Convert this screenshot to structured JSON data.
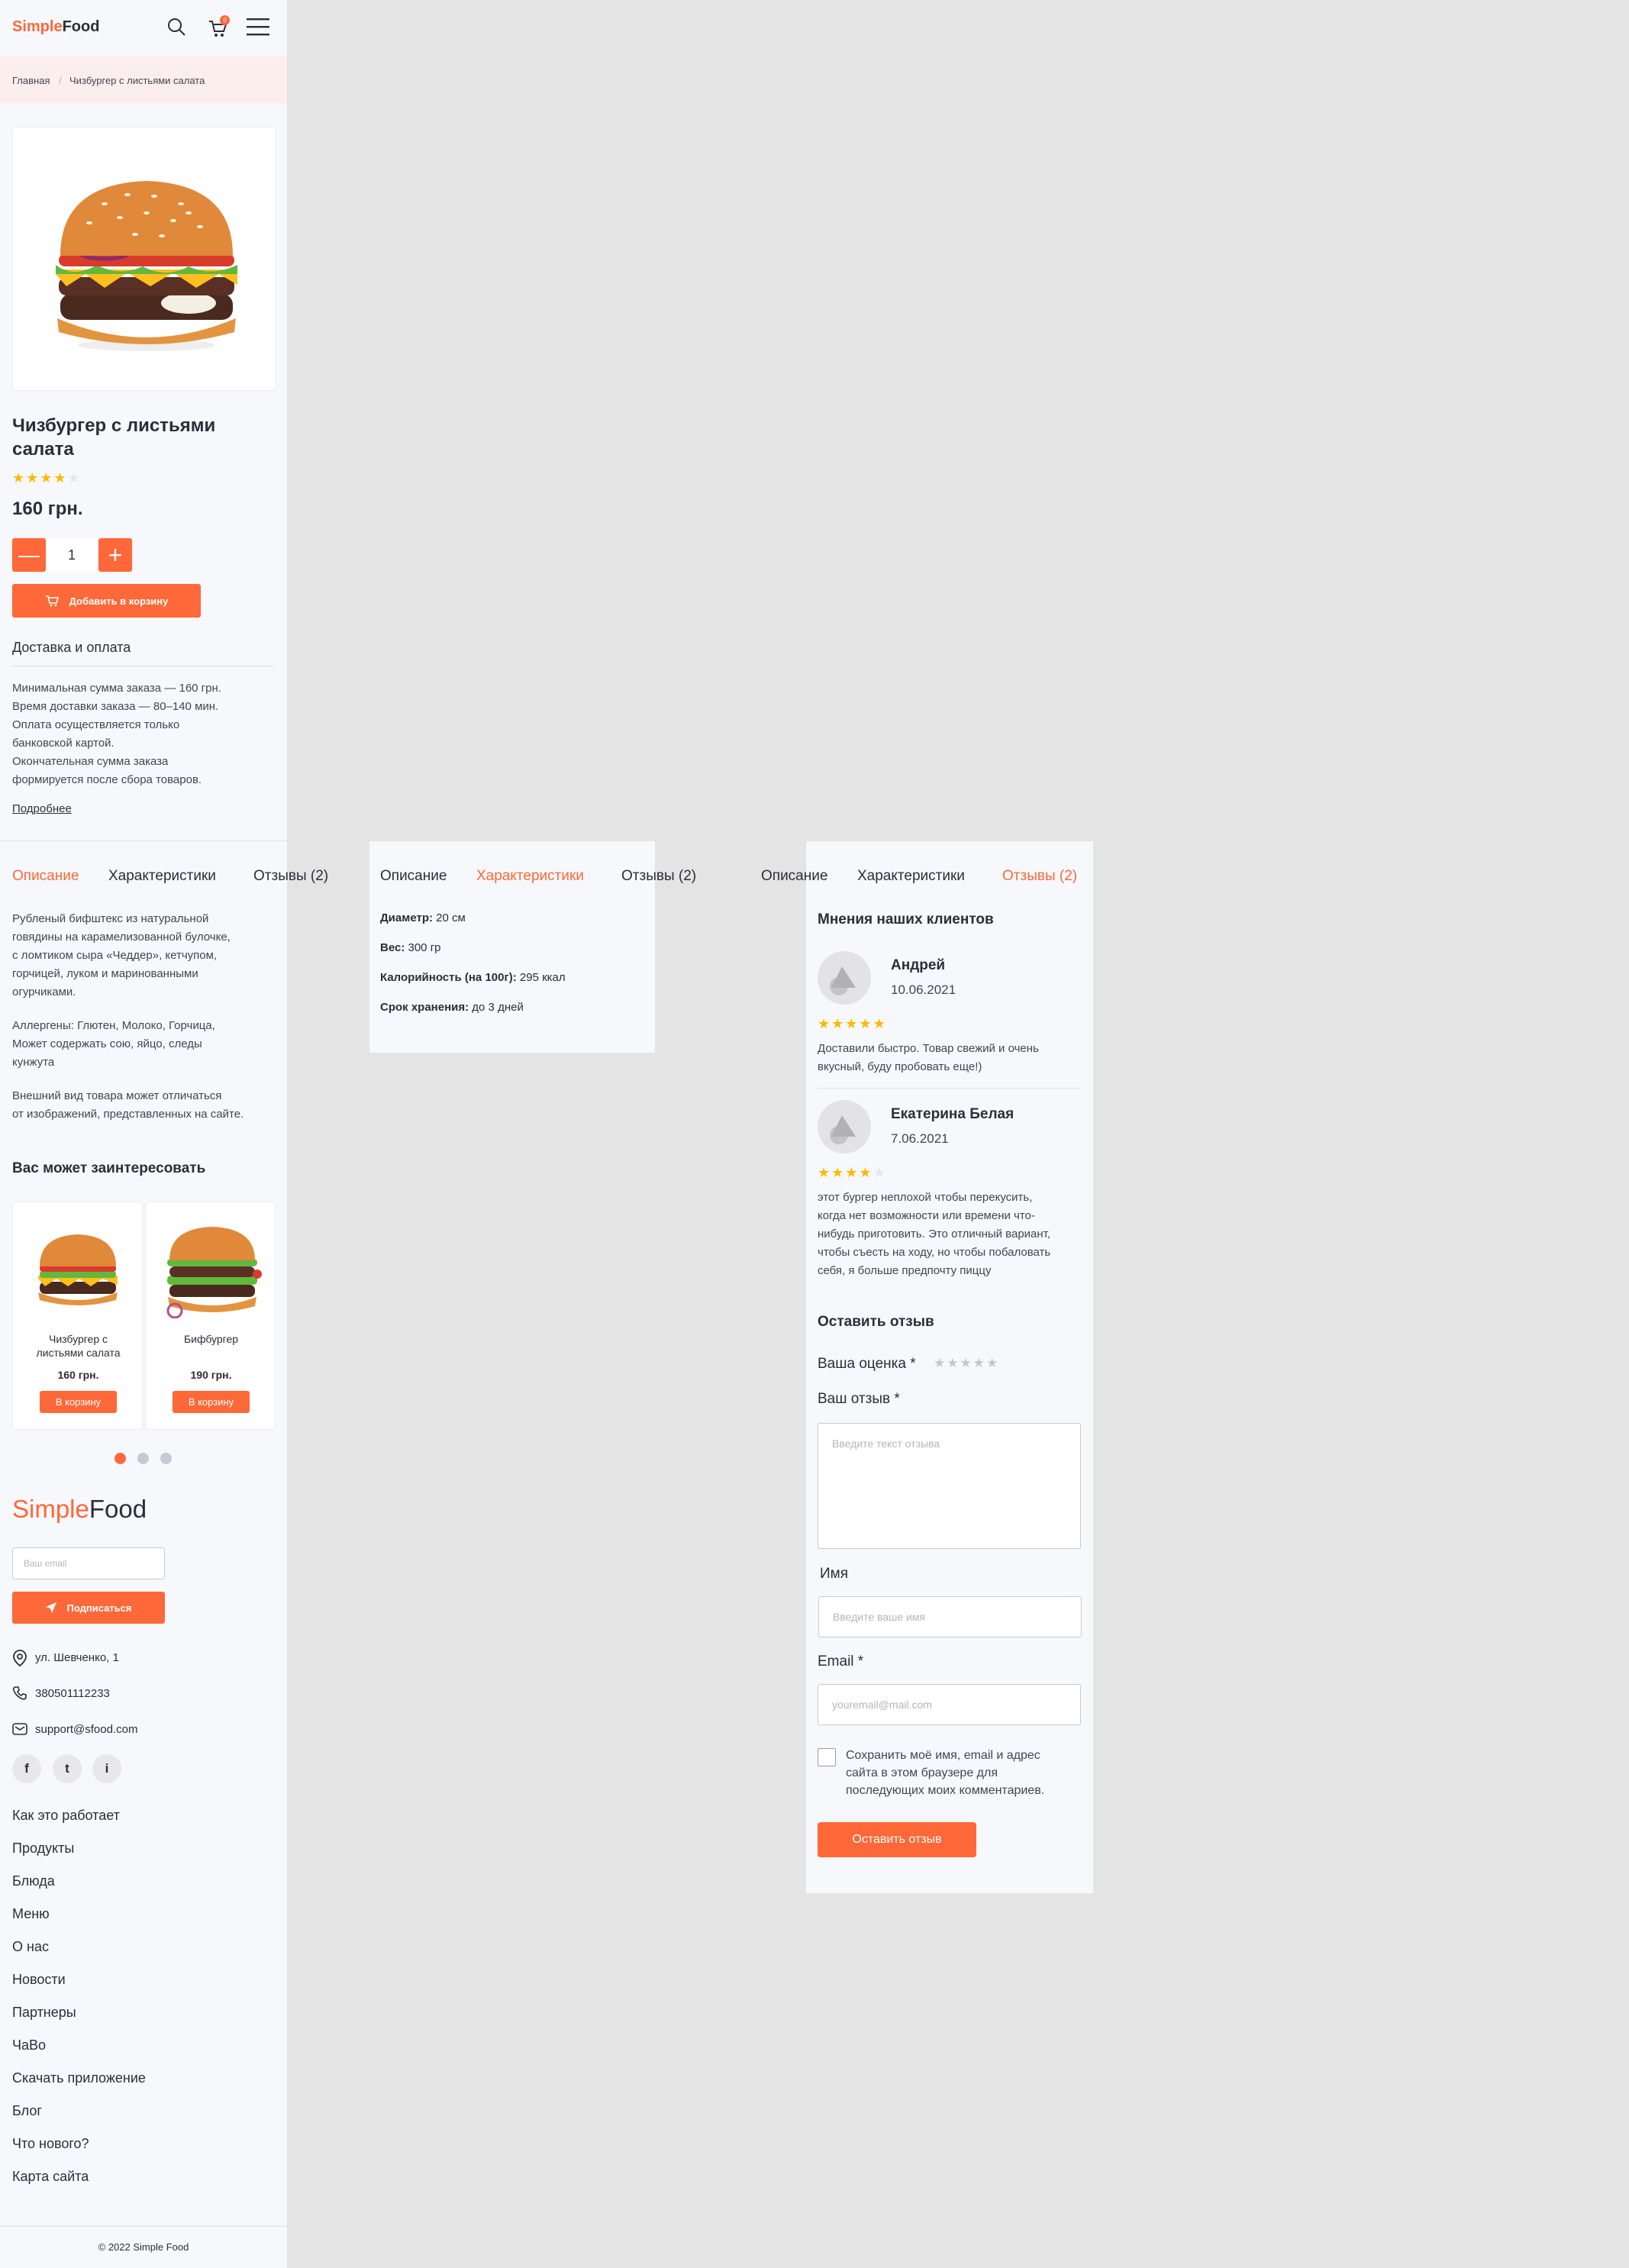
{
  "header": {
    "logo_a": "Simple",
    "logo_b": "Food",
    "cart_count": "0"
  },
  "breadcrumb": {
    "home": "Главная",
    "sep": "/",
    "current": "Чизбургер с листьями салата"
  },
  "product": {
    "title_line1": "Чизбургер с листьями",
    "title_line2": "салата",
    "rating": 4,
    "rating_max": 5,
    "price": "160 грн.",
    "quantity": "1",
    "add_to_cart": "Добавить в корзину"
  },
  "delivery": {
    "heading": "Доставка и оплата",
    "lines": [
      "Минимальная сумма заказа — 160 грн.",
      "Время доставки заказа — 80–140 мин.",
      "Оплата осуществляется только",
      "банковской картой.",
      "Окончательная сумма заказа",
      "формируется после сбора товаров."
    ],
    "more": "Подробнее"
  },
  "tabs": {
    "description": "Описание",
    "characteristics": "Характеристики",
    "reviews": "Отзывы (2)"
  },
  "description": {
    "p1": [
      "Рубленый бифштекс из натуральной",
      "говядины на карамелизованной булочке,",
      "с ломтиком сыра «Чеддер», кетчупом,",
      "горчицей, луком и маринованными",
      "огурчиками."
    ],
    "p2": [
      "Аллергены: Глютен, Молоко, Горчица,",
      "Может содержать сою, яйцо, следы",
      "кунжута"
    ],
    "p3": [
      "Внешний вид товара может отличаться",
      "от изображений, представленных на сайте."
    ]
  },
  "characteristics": [
    {
      "label": "Диаметр:",
      "value": " 20 см"
    },
    {
      "label": "Вес:",
      "value": " 300 гр"
    },
    {
      "label": "Калорийность (на 100г):",
      "value": " 295 ккал"
    },
    {
      "label": "Срок хранения:",
      "value": " до 3 дней"
    }
  ],
  "related": {
    "heading": "Вас может заинтересовать",
    "items": [
      {
        "name_l1": "Чизбургер с",
        "name_l2": "листьями салата",
        "price": "160 грн.",
        "button": "В корзину"
      },
      {
        "name_l1": "Бифбургер",
        "name_l2": "",
        "price": "190 грн.",
        "button": "В корзину"
      }
    ]
  },
  "footer": {
    "logo_a": "Simple",
    "logo_b": "Food",
    "email_placeholder": "Ваш email",
    "subscribe": "Подписаться",
    "address": "ул. Шевченко, 1",
    "phone": "380501112233",
    "email": "support@sfood.com",
    "social": [
      "f",
      "t",
      "i"
    ],
    "menu": [
      "Как это работает",
      "Продукты",
      "Блюда",
      "Меню",
      "О нас",
      "Новости",
      "Партнеры",
      "ЧаВо",
      "Скачать приложение",
      "Блог",
      "Что нового?",
      "Карта сайта"
    ],
    "copyright": "© 2022 Simple Food"
  },
  "reviews": {
    "heading": "Мнения наших клиентов",
    "items": [
      {
        "name": "Андрей",
        "date": "10.06.2021",
        "rating": 5,
        "text": [
          "Доставили быстро. Товар свежий и очень",
          "вкусный, буду пробовать еще!)"
        ]
      },
      {
        "name": "Екатерина Белая",
        "date": "7.06.2021",
        "rating": 4,
        "text": [
          "этот бургер неплохой чтобы перекусить,",
          "когда нет возможности или времени что-",
          "нибудь приготовить. Это отличный вариант,",
          "чтобы съесть на ходу, но чтобы побаловать",
          "себя, я больше предпочту пиццу"
        ]
      }
    ]
  },
  "review_form": {
    "heading": "Оставить отзыв",
    "rating_label": "Ваша оценка *",
    "review_label": "Ваш отзыв *",
    "review_placeholder": "Введите текст отзыва",
    "name_label": "Имя",
    "name_placeholder": "Введите ваше имя",
    "email_label": "Email *",
    "email_placeholder": "youremail@mail.com",
    "save_lines": [
      "Сохранить моё имя, email и адрес",
      "сайта в этом браузере для",
      "последующих моих комментариев."
    ],
    "submit": "Оставить отзыв"
  },
  "colors": {
    "accent": "#ff6838",
    "star": "#ffb800",
    "panel": "#f7f8fc",
    "backdrop": "#e4e4e4"
  }
}
